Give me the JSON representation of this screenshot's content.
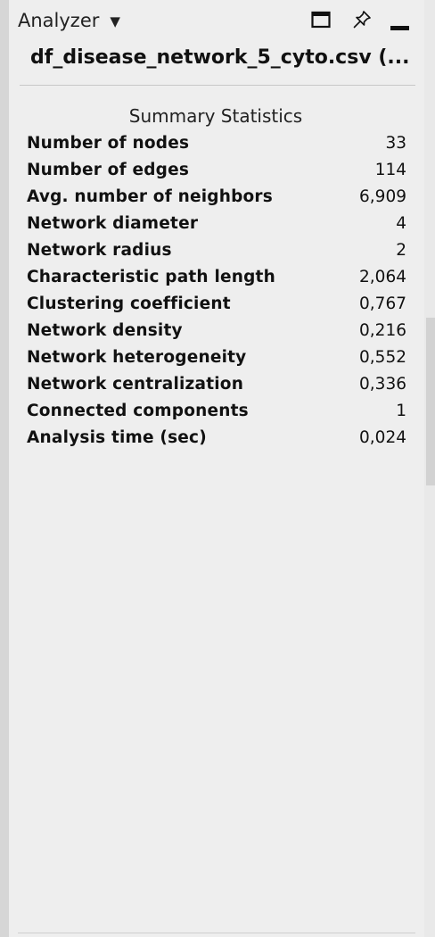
{
  "header": {
    "menu_label": "Analyzer",
    "menu_caret": "▼",
    "icons": [
      "maximize-icon",
      "pin-icon",
      "minimize-icon"
    ]
  },
  "document": {
    "title": "df_disease_network_5_cyto.csv (..."
  },
  "summary": {
    "title": "Summary Statistics",
    "rows": [
      {
        "label": "Number of nodes",
        "value": "33"
      },
      {
        "label": "Number of edges",
        "value": "114"
      },
      {
        "label": "Avg. number of neighbors",
        "value": "6,909"
      },
      {
        "label": "Network diameter",
        "value": "4"
      },
      {
        "label": "Network radius",
        "value": "2"
      },
      {
        "label": "Characteristic path length",
        "value": "2,064"
      },
      {
        "label": "Clustering coefficient",
        "value": "0,767"
      },
      {
        "label": "Network density",
        "value": "0,216"
      },
      {
        "label": "Network heterogeneity",
        "value": "0,552"
      },
      {
        "label": "Network centralization",
        "value": "0,336"
      },
      {
        "label": "Connected components",
        "value": "1"
      },
      {
        "label": "Analysis time (sec)",
        "value": "0,024"
      }
    ]
  }
}
